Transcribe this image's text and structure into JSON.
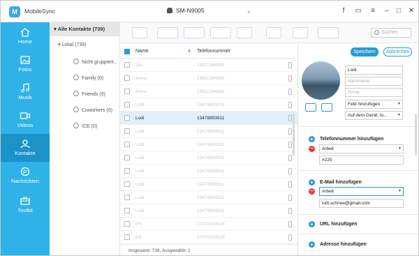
{
  "app": {
    "name": "MobileSync",
    "device": "SM-N9005"
  },
  "nav": [
    {
      "label": "Home"
    },
    {
      "label": "Fotos"
    },
    {
      "label": "Musik"
    },
    {
      "label": "Videos"
    },
    {
      "label": "Kontakte"
    },
    {
      "label": "Nachrichten"
    },
    {
      "label": "Toolkit"
    }
  ],
  "tree": {
    "all": "Alle Kontakte (739)",
    "local": "Lokal (739)",
    "groups": [
      "Nicht gruppiert...",
      "Family (0)",
      "Friends (0)",
      "Coworkers (0)",
      "ICE (0)"
    ]
  },
  "search": {
    "placeholder": "Suchen"
  },
  "list": {
    "col_name": "Name",
    "col_phone": "Telefonnummer",
    "rows": [
      {
        "name": "Jon",
        "phone": "13811384589"
      },
      {
        "name": "Anna",
        "phone": "13811384589"
      },
      {
        "name": "Anna",
        "phone": "13811384589"
      },
      {
        "name": "Lodi",
        "phone": "13478893911"
      },
      {
        "name": "Lodi",
        "phone": "13478893911"
      },
      {
        "name": "Lodi",
        "phone": "13478893911"
      },
      {
        "name": "Lodi",
        "phone": "13478893911"
      },
      {
        "name": "Lodi",
        "phone": "13478893911"
      },
      {
        "name": "Lodi",
        "phone": "13478893911"
      },
      {
        "name": "Lodi",
        "phone": "13478893911"
      },
      {
        "name": "Lodi",
        "phone": "13478893911"
      },
      {
        "name": "Lodi",
        "phone": "13478893911"
      },
      {
        "name": "PS",
        "phone": "17070316518"
      },
      {
        "name": "PS",
        "phone": "17070316518"
      }
    ],
    "footer": "Insgesamt: 739; Ausgewählt: 2"
  },
  "detail": {
    "save": "Speichern",
    "cancel": "Abbrechen",
    "first_name": "Lodi",
    "last_name_placeholder": "Nachname",
    "company_placeholder": "Firma",
    "add_field": "Feld hinzufügen",
    "storage": "Auf dem Gerät: lo...",
    "phone_section": "Telefonnummer hinzufügen",
    "phone_type": "Arbeit",
    "phone_value": "#225",
    "email_section": "E-Mail hinzufügen",
    "email_type": "Arbeit",
    "email_value": "lodi.schnee@gmail.com",
    "url_section": "URL hinzufügen",
    "address_section": "Adresse hinzufügen"
  }
}
